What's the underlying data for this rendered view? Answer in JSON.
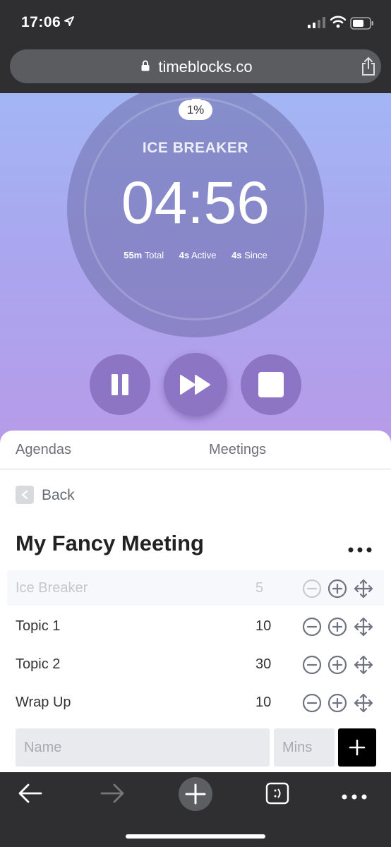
{
  "status_bar": {
    "time": "17:06"
  },
  "browser": {
    "url": "timeblocks.co"
  },
  "timer": {
    "progress_label": "1%",
    "segment_title": "ICE BREAKER",
    "countdown": "04:56",
    "stats": [
      {
        "value": "55m",
        "label": "Total"
      },
      {
        "value": "4s",
        "label": "Active"
      },
      {
        "value": "4s",
        "label": "Since"
      }
    ]
  },
  "tabs": {
    "agendas": "Agendas",
    "meetings": "Meetings"
  },
  "back_label": "Back",
  "meeting_title": "My Fancy Meeting",
  "agenda_items": [
    {
      "name": "Ice Breaker",
      "minutes": "5",
      "state": "active"
    },
    {
      "name": "Topic 1",
      "minutes": "10",
      "state": "pending"
    },
    {
      "name": "Topic 2",
      "minutes": "30",
      "state": "pending"
    },
    {
      "name": "Wrap Up",
      "minutes": "10",
      "state": "pending"
    }
  ],
  "add_form": {
    "name_placeholder": "Name",
    "mins_placeholder": "Mins"
  },
  "icons": {
    "pause": "pause-icon",
    "skip": "fast-forward-icon",
    "stop": "stop-icon",
    "decrement": "minus-circle-icon",
    "increment": "plus-circle-icon",
    "reorder": "move-arrows-icon"
  },
  "colors": {
    "accent_gradient_top": "#a3b6f4",
    "accent_gradient_bottom": "#b79be8",
    "add_button": "#000000"
  }
}
